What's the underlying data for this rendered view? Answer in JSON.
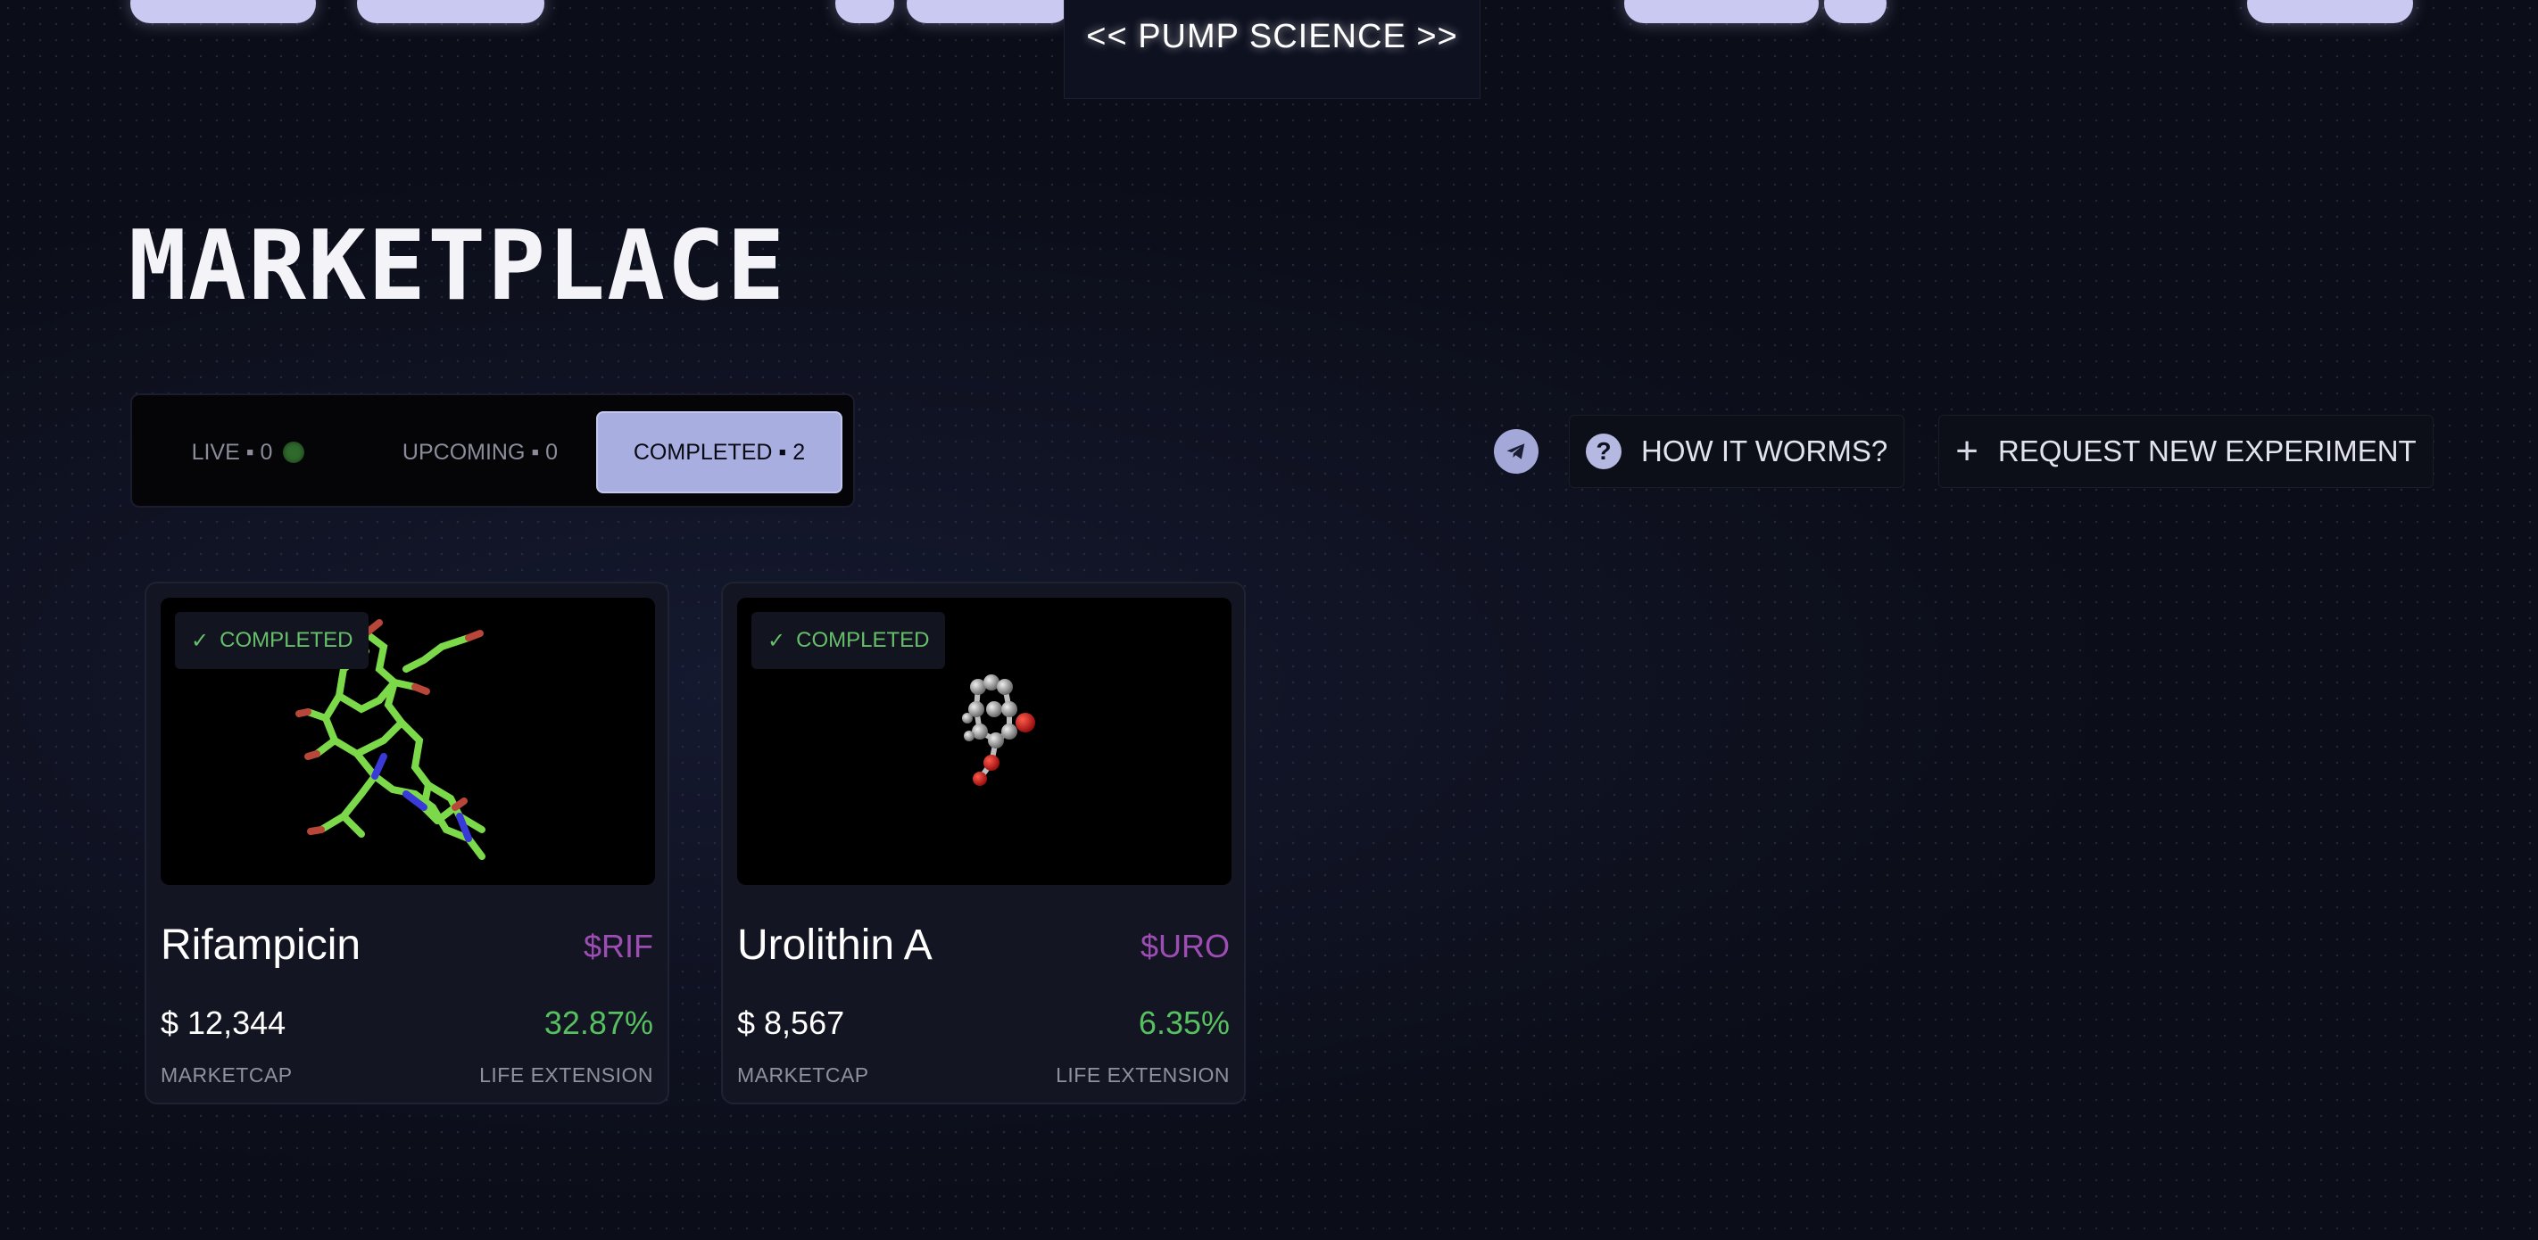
{
  "header": {
    "brand": "<< PUMP SCIENCE >>"
  },
  "page": {
    "title": "MARKETPLACE"
  },
  "filters": {
    "live_label": "LIVE ▪ 0",
    "upcoming_label": "UPCOMING ▪ 0",
    "completed_label": "COMPLETED ▪ 2",
    "selected": "completed"
  },
  "actions": {
    "telegram_icon": "telegram-icon",
    "how_label": "HOW IT WORMS?",
    "how_icon_glyph": "?",
    "request_label": "REQUEST NEW EXPERIMENT",
    "request_icon_glyph": "+"
  },
  "cards": [
    {
      "status": "COMPLETED",
      "check": "✓",
      "name": "Rifampicin",
      "ticker": "$RIF",
      "marketcap": "$ 12,344",
      "marketcap_label": "MARKETCAP",
      "life_extension": "32.87%",
      "life_extension_label": "LIFE EXTENSION"
    },
    {
      "status": "COMPLETED",
      "check": "✓",
      "name": "Urolithin A",
      "ticker": "$URO",
      "marketcap": "$ 8,567",
      "marketcap_label": "MARKETCAP",
      "life_extension": "6.35%",
      "life_extension_label": "LIFE EXTENSION"
    }
  ],
  "colors": {
    "background": "#0b0d18",
    "accent_selected": "#a9aee0",
    "ticker": "#9d4db3",
    "positive": "#57c060",
    "badge_text": "#66bf6a"
  }
}
